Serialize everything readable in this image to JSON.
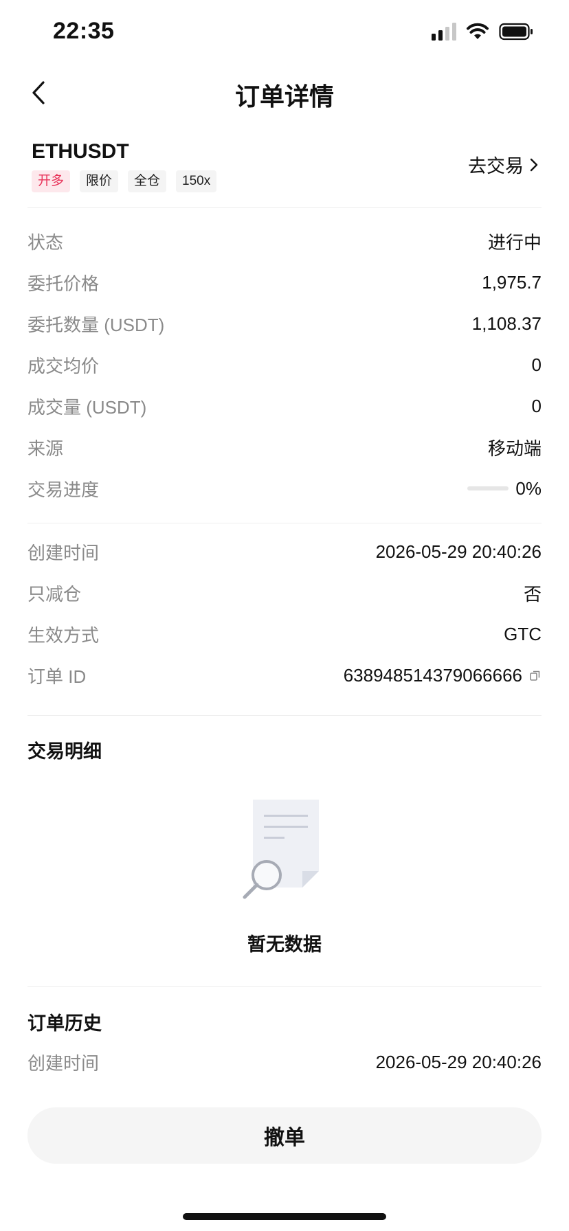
{
  "status_bar": {
    "time": "22:35"
  },
  "nav": {
    "title": "订单详情"
  },
  "symbol": {
    "name": "ETHUSDT",
    "tags": [
      "开多",
      "限价",
      "全仓",
      "150x"
    ],
    "go_trade_label": "去交易"
  },
  "details": [
    {
      "label": "状态",
      "value": "进行中"
    },
    {
      "label": "委托价格",
      "value": "1,975.7"
    },
    {
      "label": "委托数量 (USDT)",
      "value": "1,108.37"
    },
    {
      "label": "成交均价",
      "value": "0"
    },
    {
      "label": "成交量 (USDT)",
      "value": "0"
    },
    {
      "label": "来源",
      "value": "移动端"
    },
    {
      "label": "交易进度",
      "value": "0%",
      "progress": 0
    }
  ],
  "details2": [
    {
      "label": "创建时间",
      "value": "2026-05-29 20:40:26"
    },
    {
      "label": "只减仓",
      "value": "否"
    },
    {
      "label": "生效方式",
      "value": "GTC"
    },
    {
      "label": "订单 ID",
      "value": "638948514379066666"
    }
  ],
  "trade_detail": {
    "title": "交易明细",
    "empty_text": "暂无数据"
  },
  "order_history": {
    "title": "订单历史",
    "rows": [
      {
        "label": "创建时间",
        "value": "2026-05-29 20:40:26"
      }
    ]
  },
  "actions": {
    "cancel_label": "撤单"
  },
  "colors": {
    "long_tag_text": "#e8345a",
    "long_tag_bg": "#fde8ec",
    "label_gray": "#8a8a8a"
  },
  "icons": [
    "back-arrow-icon",
    "chevron-right-icon",
    "copy-icon",
    "empty-document-search-icon",
    "signal-icon",
    "wifi-icon",
    "battery-icon"
  ]
}
